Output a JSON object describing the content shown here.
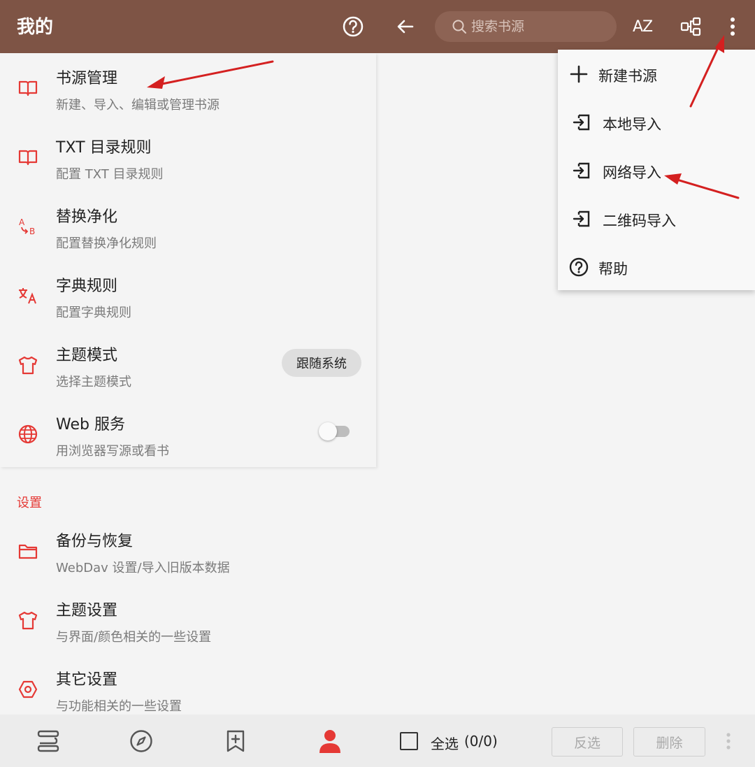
{
  "topbar": {
    "title": "我的",
    "search_placeholder": "搜索书源",
    "sort_label": "AZ"
  },
  "my_items": [
    {
      "title": "书源管理",
      "subtitle": "新建、导入、编辑或管理书源",
      "icon": "book-icon"
    },
    {
      "title": "TXT 目录规则",
      "subtitle": "配置 TXT 目录规则",
      "icon": "book-icon"
    },
    {
      "title": "替换净化",
      "subtitle": "配置替换净化规则",
      "icon": "replace-ab-icon"
    },
    {
      "title": "字典规则",
      "subtitle": "配置字典规则",
      "icon": "translate-icon"
    },
    {
      "title": "主题模式",
      "subtitle": "选择主题模式",
      "icon": "shirt-icon",
      "chip": "跟随系统"
    },
    {
      "title": "Web 服务",
      "subtitle": "用浏览器写源或看书",
      "icon": "globe-icon",
      "toggle_on": false
    }
  ],
  "settings": {
    "header": "设置",
    "items": [
      {
        "title": "备份与恢复",
        "subtitle": "WebDav 设置/导入旧版本数据",
        "icon": "folder-icon"
      },
      {
        "title": "主题设置",
        "subtitle": "与界面/颜色相关的一些设置",
        "icon": "shirt-icon"
      },
      {
        "title": "其它设置",
        "subtitle": "与功能相关的一些设置",
        "icon": "hexagon-settings-icon"
      }
    ]
  },
  "menu": {
    "items": [
      {
        "label": "新建书源",
        "icon": "plus-icon"
      },
      {
        "label": "本地导入",
        "icon": "import-icon"
      },
      {
        "label": "网络导入",
        "icon": "import-icon"
      },
      {
        "label": "二维码导入",
        "icon": "import-icon"
      },
      {
        "label": "帮助",
        "icon": "help-icon"
      }
    ]
  },
  "bottom": {
    "select_all": "全选",
    "count": "(0/0)",
    "invert": "反选",
    "delete": "删除"
  },
  "colors": {
    "topbar": "#7e5445",
    "accent": "#e53935",
    "annotation_arrow": "#d42020"
  }
}
